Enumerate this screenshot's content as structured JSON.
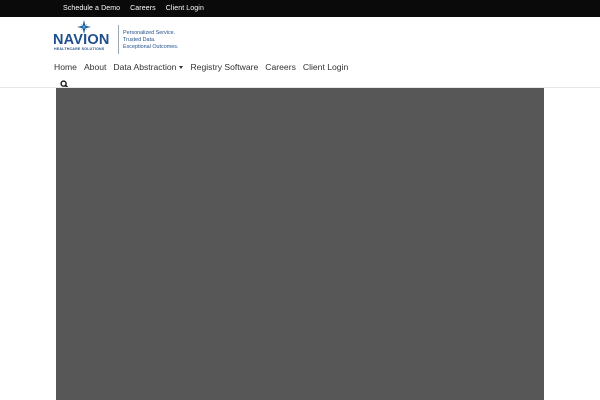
{
  "topbar": {
    "links": [
      "Schedule a Demo",
      "Careers",
      "Client Login"
    ]
  },
  "logo": {
    "name": "NAVION",
    "subtitle": "HEALTHCARE SOLUTIONS",
    "tagline": [
      "Personalized Service.",
      "Trusted Data.",
      "Exceptional Outcomes."
    ]
  },
  "nav": {
    "items": [
      "Home",
      "About",
      "Data Abstraction",
      "Registry Software",
      "Careers",
      "Client Login"
    ]
  },
  "colors": {
    "topbar_bg": "#0a0a0a",
    "brand_blue": "#1f4f8b",
    "media_bg": "#575757"
  },
  "icons": {
    "search": "search-icon",
    "dropdown": "caret-down-icon"
  }
}
